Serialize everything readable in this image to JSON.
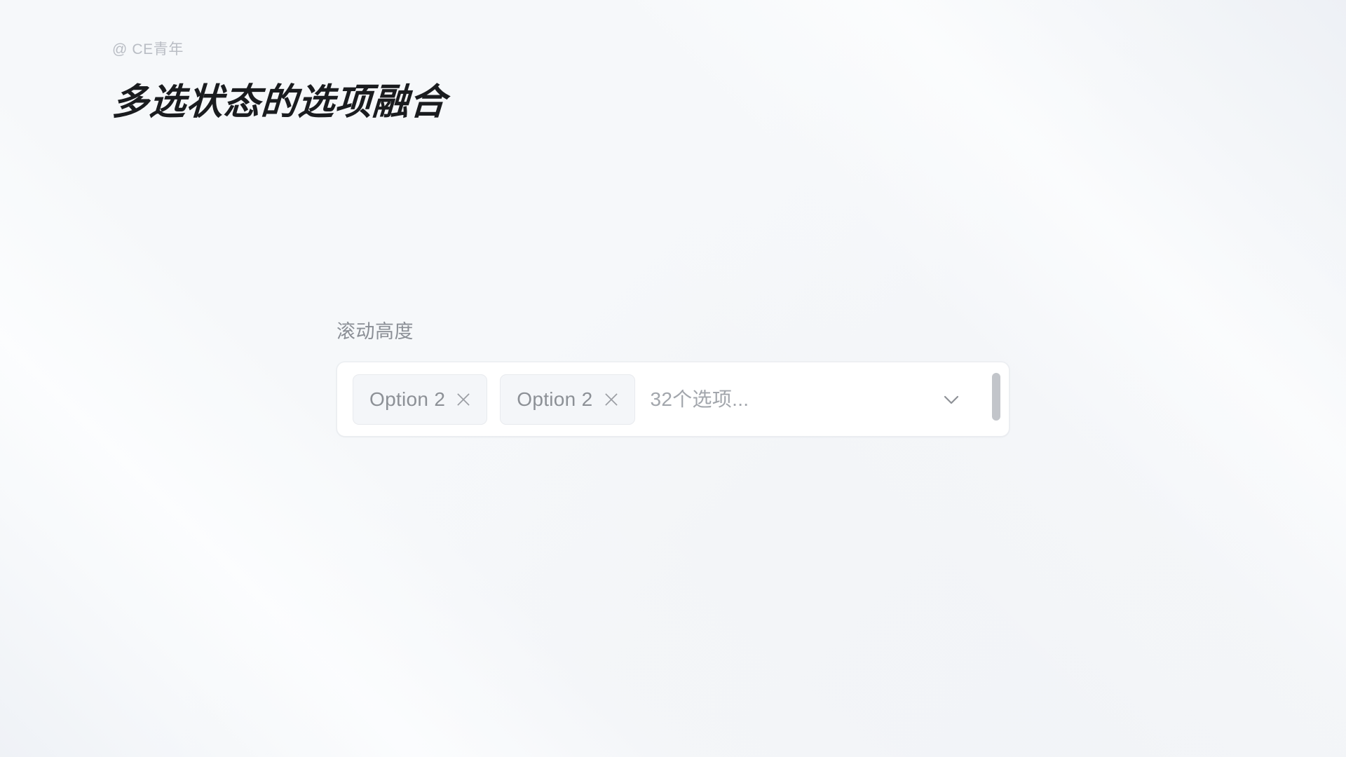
{
  "page": {
    "watermark": "@ CE青年",
    "title": "多选状态的选项融合",
    "background_color": "#f4f6f8"
  },
  "field": {
    "label": "滚动高度",
    "control_type": "multi-select",
    "placeholder": "32个选项...",
    "selected_tags": [
      {
        "label": "Option 2",
        "close_icon": "close-icon"
      },
      {
        "label": "Option 2",
        "close_icon": "close-icon"
      }
    ],
    "dropdown_icon": "chevron-down-icon",
    "scrollbar": {
      "visible": true,
      "thumb_icon": "scrollbar-thumb"
    },
    "colors": {
      "control_background": "#ffffff",
      "control_border": "#eceef1",
      "tag_background": "#f4f6f9",
      "tag_border": "#e8eaee",
      "tag_text": "#8c9096",
      "placeholder_text": "#a2a6ac",
      "label_text": "#8b8f96",
      "title_text": "#1a1c1f",
      "watermark_text": "#b9bdc4",
      "scrollbar_thumb": "#c2c5ca"
    }
  }
}
